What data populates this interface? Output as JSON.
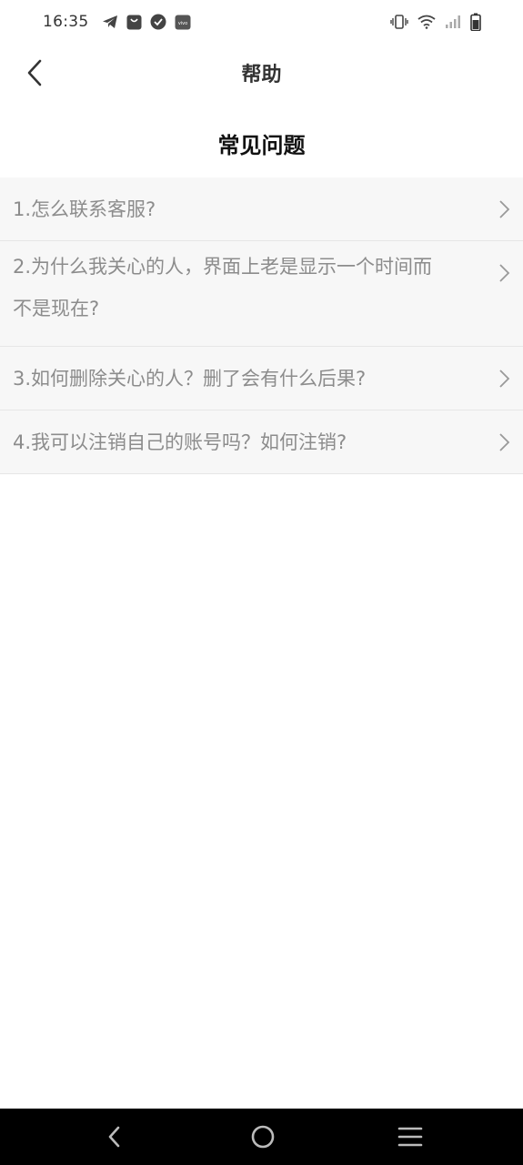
{
  "status_bar": {
    "time": "16:35",
    "left_icons": [
      "telegram-icon",
      "shopping-bag-icon",
      "check-badge-icon",
      "vivo-icon"
    ],
    "vivo_text": "vivo",
    "right_icons": [
      "vibrate-icon",
      "wifi-icon",
      "signal-icon",
      "battery-icon"
    ]
  },
  "header": {
    "back_icon": "chevron-left-icon",
    "title": "帮助"
  },
  "section": {
    "title": "常见问题"
  },
  "faq": [
    {
      "text": "1.怎么联系客服?"
    },
    {
      "line1": "2.为什么我关心的人，界面上老是显示一个时间而",
      "line2": "不是现在?"
    },
    {
      "text": "3.如何删除关心的人？删了会有什么后果?"
    },
    {
      "text": "4.我可以注销自己的账号吗？如何注销?"
    }
  ],
  "nav_bar": {
    "icons": [
      "nav-back-icon",
      "nav-home-icon",
      "nav-menu-icon"
    ]
  },
  "colors": {
    "item_background": "#f7f7f7",
    "item_text": "#8c8c8c",
    "divider": "#e6e6e6",
    "nav_background": "#000000"
  }
}
